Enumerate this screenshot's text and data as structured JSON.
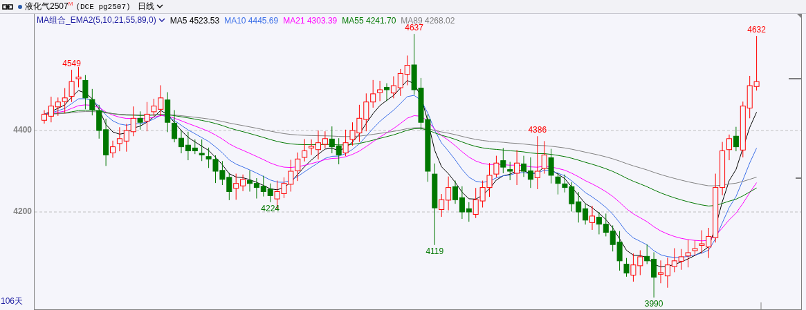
{
  "header": {
    "symbol": "液化气2507",
    "symbol_mark": "M",
    "code": "(DCE pg2507)",
    "period": "日线"
  },
  "legend": {
    "indicator": "MA组合_EMA2(5,10,21,55,89,0)",
    "items": [
      {
        "label": "MA5 4523.53",
        "color": "#000000"
      },
      {
        "label": "MA10 4445.69",
        "color": "#3a6ee8"
      },
      {
        "label": "MA21 4303.39",
        "color": "#ff00ff"
      },
      {
        "label": "MA55 4241.70",
        "color": "#007700"
      },
      {
        "label": "MA89 4268.02",
        "color": "#808080"
      }
    ]
  },
  "y_axis": {
    "ticks": [
      "4400",
      "4200"
    ]
  },
  "annotations": [
    {
      "text": "4549",
      "kind": "high"
    },
    {
      "text": "4224",
      "kind": "low"
    },
    {
      "text": "4637",
      "kind": "high"
    },
    {
      "text": "4119",
      "kind": "low"
    },
    {
      "text": "4386",
      "kind": "high"
    },
    {
      "text": "3990",
      "kind": "low"
    },
    {
      "text": "4632",
      "kind": "high"
    }
  ],
  "footer": {
    "days": "106天"
  }
}
